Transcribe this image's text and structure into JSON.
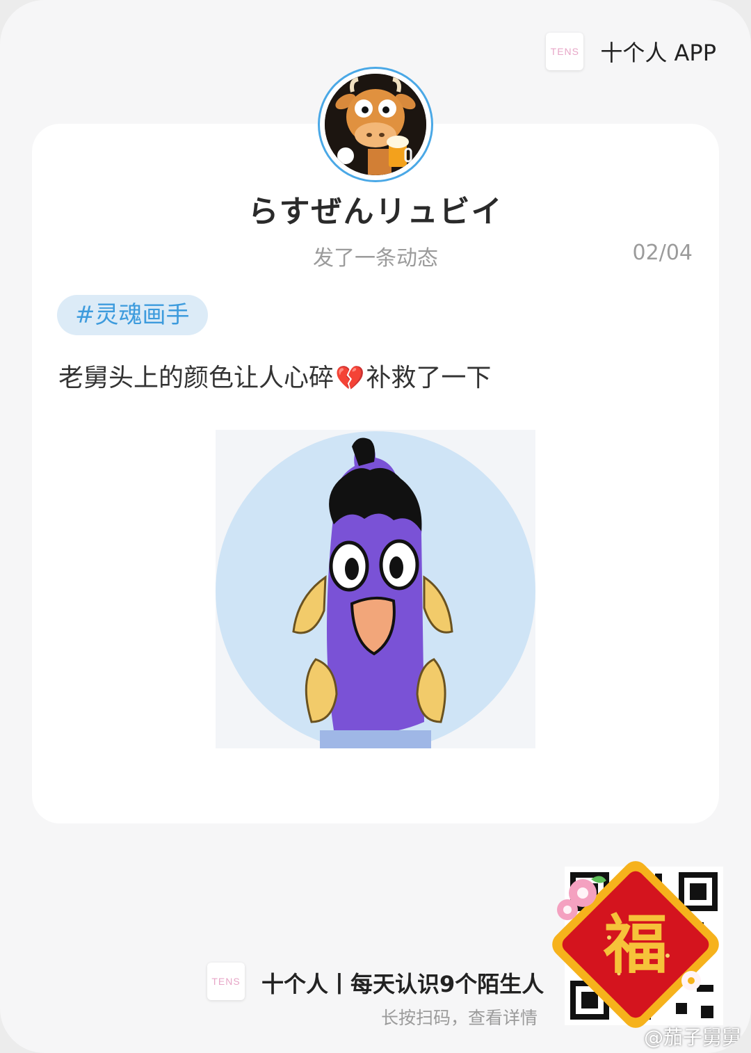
{
  "header": {
    "logo_text": "TENS",
    "app_name": "十个人 APP"
  },
  "post": {
    "username": "らすぜんリュビイ",
    "action": "发了一条动态",
    "date": "02/04",
    "tag": "#灵魂画手",
    "text_before": "老舅头上的颜色让人心碎",
    "emoji": "💔",
    "text_after": "补救了一下"
  },
  "footer": {
    "logo_text": "TENS",
    "title": "十个人丨每天认识9个陌生人",
    "subtitle": "长按扫码，查看详情",
    "sticker_char": "福"
  },
  "watermark": {
    "icon": "微博",
    "text": "@茄子舅舅"
  },
  "colors": {
    "accent": "#3d9bdd",
    "tag_bg": "#dcebf7",
    "avatar_ring": "#4aa8e6"
  }
}
